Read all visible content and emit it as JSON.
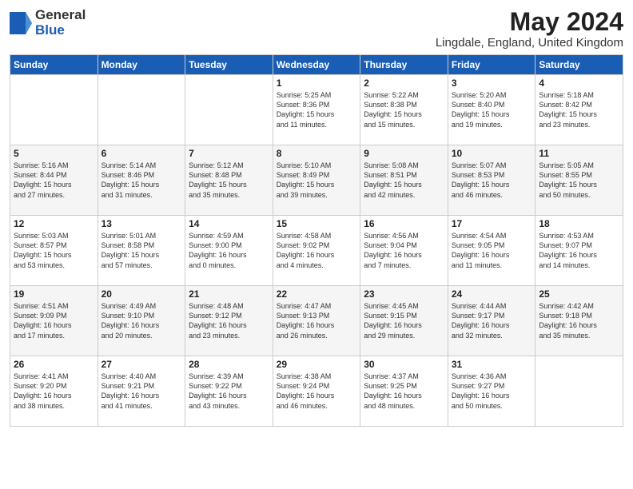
{
  "header": {
    "logo_general": "General",
    "logo_blue": "Blue",
    "title": "May 2024",
    "subtitle": "Lingdale, England, United Kingdom"
  },
  "weekdays": [
    "Sunday",
    "Monday",
    "Tuesday",
    "Wednesday",
    "Thursday",
    "Friday",
    "Saturday"
  ],
  "weeks": [
    [
      {
        "day": "",
        "info": ""
      },
      {
        "day": "",
        "info": ""
      },
      {
        "day": "",
        "info": ""
      },
      {
        "day": "1",
        "info": "Sunrise: 5:25 AM\nSunset: 8:36 PM\nDaylight: 15 hours\nand 11 minutes."
      },
      {
        "day": "2",
        "info": "Sunrise: 5:22 AM\nSunset: 8:38 PM\nDaylight: 15 hours\nand 15 minutes."
      },
      {
        "day": "3",
        "info": "Sunrise: 5:20 AM\nSunset: 8:40 PM\nDaylight: 15 hours\nand 19 minutes."
      },
      {
        "day": "4",
        "info": "Sunrise: 5:18 AM\nSunset: 8:42 PM\nDaylight: 15 hours\nand 23 minutes."
      }
    ],
    [
      {
        "day": "5",
        "info": "Sunrise: 5:16 AM\nSunset: 8:44 PM\nDaylight: 15 hours\nand 27 minutes."
      },
      {
        "day": "6",
        "info": "Sunrise: 5:14 AM\nSunset: 8:46 PM\nDaylight: 15 hours\nand 31 minutes."
      },
      {
        "day": "7",
        "info": "Sunrise: 5:12 AM\nSunset: 8:48 PM\nDaylight: 15 hours\nand 35 minutes."
      },
      {
        "day": "8",
        "info": "Sunrise: 5:10 AM\nSunset: 8:49 PM\nDaylight: 15 hours\nand 39 minutes."
      },
      {
        "day": "9",
        "info": "Sunrise: 5:08 AM\nSunset: 8:51 PM\nDaylight: 15 hours\nand 42 minutes."
      },
      {
        "day": "10",
        "info": "Sunrise: 5:07 AM\nSunset: 8:53 PM\nDaylight: 15 hours\nand 46 minutes."
      },
      {
        "day": "11",
        "info": "Sunrise: 5:05 AM\nSunset: 8:55 PM\nDaylight: 15 hours\nand 50 minutes."
      }
    ],
    [
      {
        "day": "12",
        "info": "Sunrise: 5:03 AM\nSunset: 8:57 PM\nDaylight: 15 hours\nand 53 minutes."
      },
      {
        "day": "13",
        "info": "Sunrise: 5:01 AM\nSunset: 8:58 PM\nDaylight: 15 hours\nand 57 minutes."
      },
      {
        "day": "14",
        "info": "Sunrise: 4:59 AM\nSunset: 9:00 PM\nDaylight: 16 hours\nand 0 minutes."
      },
      {
        "day": "15",
        "info": "Sunrise: 4:58 AM\nSunset: 9:02 PM\nDaylight: 16 hours\nand 4 minutes."
      },
      {
        "day": "16",
        "info": "Sunrise: 4:56 AM\nSunset: 9:04 PM\nDaylight: 16 hours\nand 7 minutes."
      },
      {
        "day": "17",
        "info": "Sunrise: 4:54 AM\nSunset: 9:05 PM\nDaylight: 16 hours\nand 11 minutes."
      },
      {
        "day": "18",
        "info": "Sunrise: 4:53 AM\nSunset: 9:07 PM\nDaylight: 16 hours\nand 14 minutes."
      }
    ],
    [
      {
        "day": "19",
        "info": "Sunrise: 4:51 AM\nSunset: 9:09 PM\nDaylight: 16 hours\nand 17 minutes."
      },
      {
        "day": "20",
        "info": "Sunrise: 4:49 AM\nSunset: 9:10 PM\nDaylight: 16 hours\nand 20 minutes."
      },
      {
        "day": "21",
        "info": "Sunrise: 4:48 AM\nSunset: 9:12 PM\nDaylight: 16 hours\nand 23 minutes."
      },
      {
        "day": "22",
        "info": "Sunrise: 4:47 AM\nSunset: 9:13 PM\nDaylight: 16 hours\nand 26 minutes."
      },
      {
        "day": "23",
        "info": "Sunrise: 4:45 AM\nSunset: 9:15 PM\nDaylight: 16 hours\nand 29 minutes."
      },
      {
        "day": "24",
        "info": "Sunrise: 4:44 AM\nSunset: 9:17 PM\nDaylight: 16 hours\nand 32 minutes."
      },
      {
        "day": "25",
        "info": "Sunrise: 4:42 AM\nSunset: 9:18 PM\nDaylight: 16 hours\nand 35 minutes."
      }
    ],
    [
      {
        "day": "26",
        "info": "Sunrise: 4:41 AM\nSunset: 9:20 PM\nDaylight: 16 hours\nand 38 minutes."
      },
      {
        "day": "27",
        "info": "Sunrise: 4:40 AM\nSunset: 9:21 PM\nDaylight: 16 hours\nand 41 minutes."
      },
      {
        "day": "28",
        "info": "Sunrise: 4:39 AM\nSunset: 9:22 PM\nDaylight: 16 hours\nand 43 minutes."
      },
      {
        "day": "29",
        "info": "Sunrise: 4:38 AM\nSunset: 9:24 PM\nDaylight: 16 hours\nand 46 minutes."
      },
      {
        "day": "30",
        "info": "Sunrise: 4:37 AM\nSunset: 9:25 PM\nDaylight: 16 hours\nand 48 minutes."
      },
      {
        "day": "31",
        "info": "Sunrise: 4:36 AM\nSunset: 9:27 PM\nDaylight: 16 hours\nand 50 minutes."
      },
      {
        "day": "",
        "info": ""
      }
    ]
  ]
}
